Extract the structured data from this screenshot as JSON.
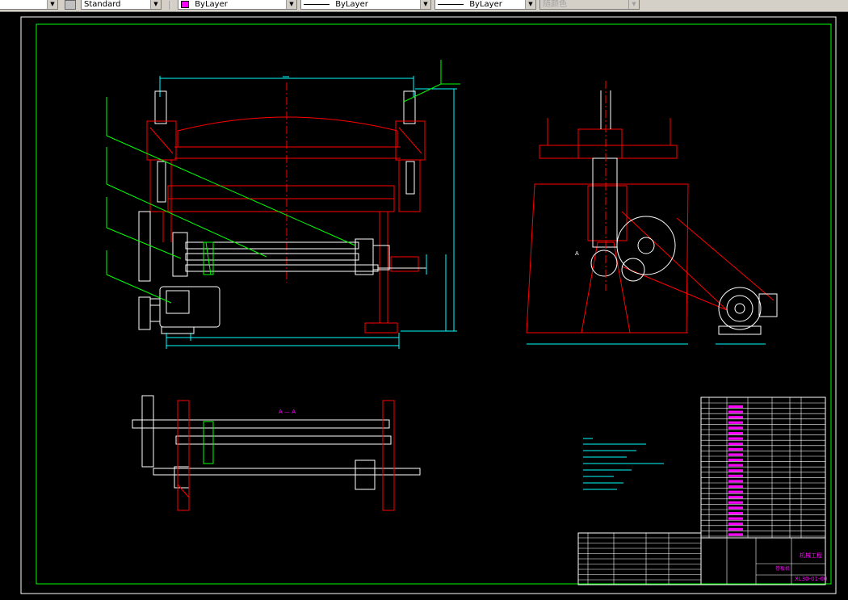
{
  "toolbar": {
    "text_style": "Standard",
    "layer": "ByLayer",
    "linetype": "ByLayer",
    "lineweight": "ByLayer",
    "plot_style": "随颜色"
  },
  "drawing": {
    "section_label": "A — A",
    "view_marker": "A",
    "title_company": "机械工程",
    "drawing_number": "XL30-01-00",
    "part_name": "卷板机",
    "colors": {
      "background": "#000000",
      "border": "#00ff00",
      "geometry": "#ff0000",
      "geometry_white": "#ffffff",
      "dimension": "#00ffff",
      "text": "#ff00ff",
      "leader": "#00ff00"
    }
  }
}
